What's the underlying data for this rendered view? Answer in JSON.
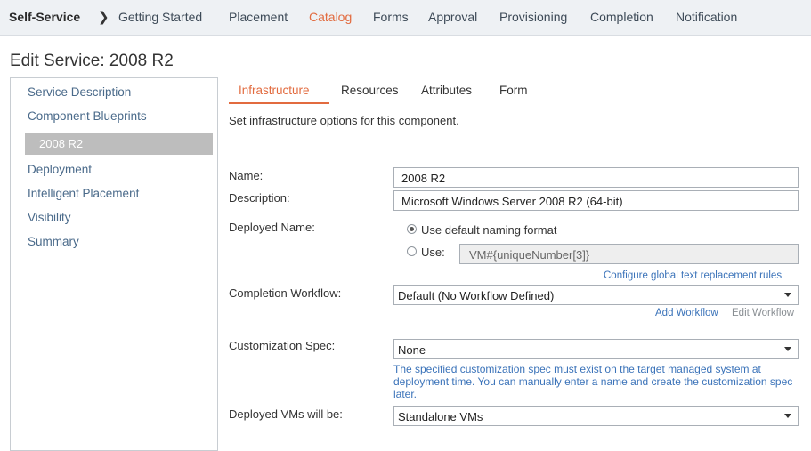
{
  "nav": {
    "brand": "Self-Service",
    "items": [
      "Getting Started",
      "Placement",
      "Catalog",
      "Forms",
      "Approval",
      "Provisioning",
      "Completion",
      "Notification"
    ],
    "active": "Catalog"
  },
  "page": {
    "title": "Edit Service: 2008 R2"
  },
  "sidebar": {
    "items": [
      "Service Description",
      "Component Blueprints",
      "2008 R2",
      "Deployment",
      "Intelligent Placement",
      "Visibility",
      "Summary"
    ],
    "selected": "2008 R2"
  },
  "tabs": {
    "items": [
      "Infrastructure",
      "Resources",
      "Attributes",
      "Form"
    ],
    "active": "Infrastructure"
  },
  "form": {
    "intro": "Set infrastructure options for this component.",
    "name_label": "Name:",
    "name_value": "2008 R2",
    "description_label": "Description:",
    "description_value": "Microsoft Windows Server 2008 R2 (64-bit)",
    "deployed_name_label": "Deployed Name:",
    "radio_default_label": "Use default naming format",
    "radio_use_label": "Use:",
    "use_value": "VM#{uniqueNumber[3]}",
    "configure_link": "Configure global text replacement rules",
    "completion_workflow_label": "Completion Workflow:",
    "completion_workflow_value": "Default (No Workflow Defined)",
    "add_workflow_link": "Add Workflow",
    "edit_workflow_link": "Edit Workflow",
    "customization_spec_label": "Customization Spec:",
    "customization_spec_value": "None",
    "customization_help": "The specified customization spec must exist on the target managed system at deployment time. You can manually enter a name and create the customization spec later.",
    "deployed_vms_label": "Deployed VMs will be:",
    "deployed_vms_value": "Standalone VMs"
  },
  "colors": {
    "accent": "#e26b3f",
    "link": "#3b73b9",
    "selected_bg": "#bdbdbd"
  }
}
